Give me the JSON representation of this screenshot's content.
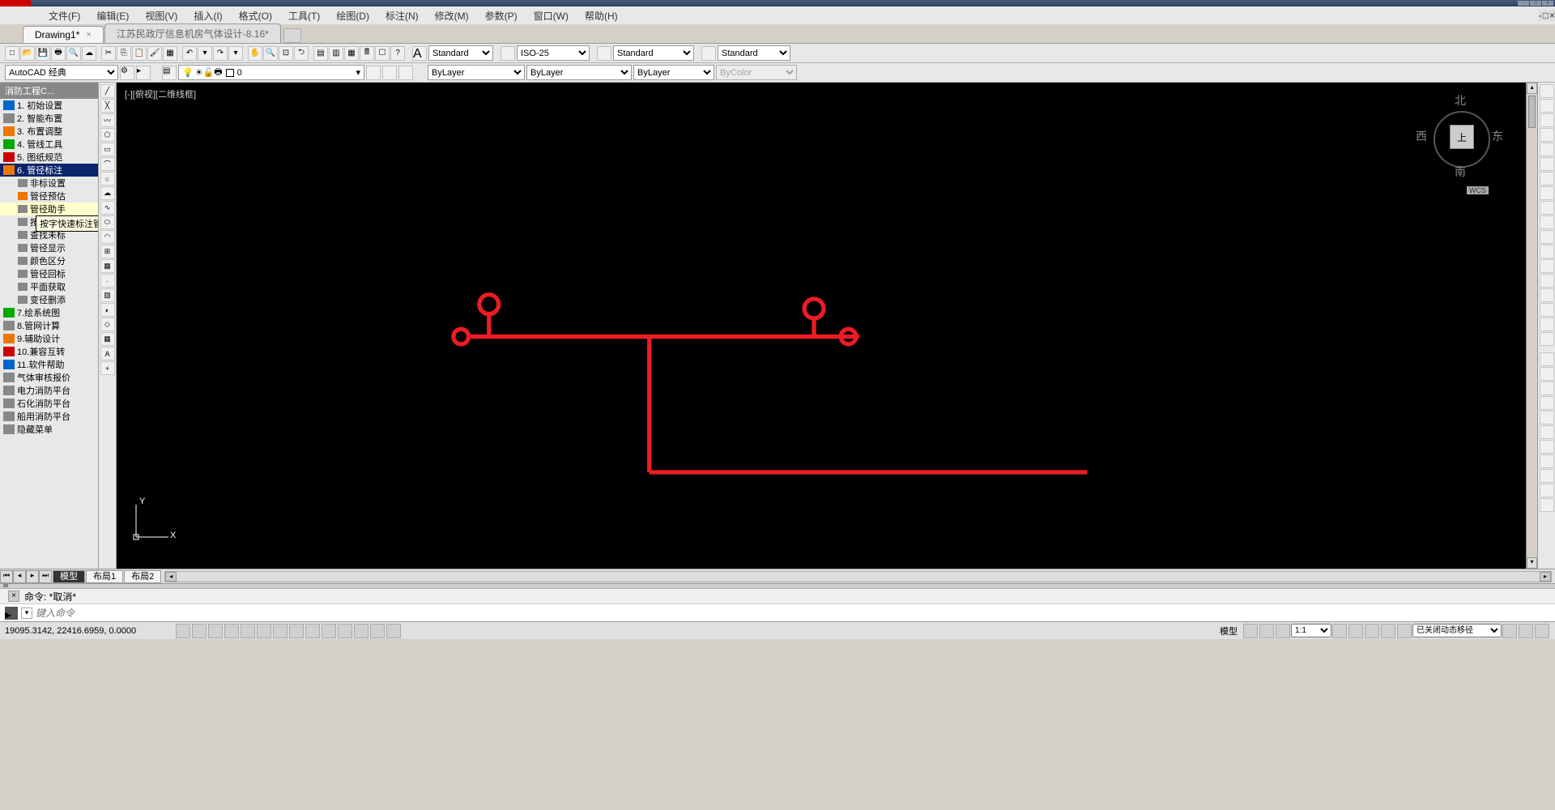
{
  "menubar": [
    "文件(F)",
    "编辑(E)",
    "视图(V)",
    "插入(I)",
    "格式(O)",
    "工具(T)",
    "绘图(D)",
    "标注(N)",
    "修改(M)",
    "参数(P)",
    "窗口(W)",
    "帮助(H)"
  ],
  "tabs": {
    "active": "Drawing1*",
    "inactive": "江苏民政厅信息机房气体设计-8.16*"
  },
  "styles": {
    "text": "Standard",
    "dim": "ISO-25",
    "table": "Standard",
    "ml": "Standard"
  },
  "workspace": "AutoCAD 经典",
  "layer": {
    "current": "0"
  },
  "props": {
    "color": "ByLayer",
    "ltype": "ByLayer",
    "lweight": "ByLayer",
    "plot": "ByColor"
  },
  "palette": {
    "title": "消防工程C...",
    "items": [
      {
        "n": "1.",
        "t": "初始设置"
      },
      {
        "n": "2.",
        "t": "智能布置"
      },
      {
        "n": "3.",
        "t": "布置调整"
      },
      {
        "n": "4.",
        "t": "管线工具"
      },
      {
        "n": "5.",
        "t": "图纸规范"
      },
      {
        "n": "6.",
        "t": "管径标注",
        "sel": true
      }
    ],
    "subs": [
      {
        "t": "非标设置"
      },
      {
        "t": "管径预估",
        "ico": "ico-orange"
      },
      {
        "t": "管径助手",
        "hover": true
      },
      {
        "t": "按字",
        "tip": "按字快速标注管径工具"
      },
      {
        "t": "查找未标"
      },
      {
        "t": "管径显示"
      },
      {
        "t": "颜色区分"
      },
      {
        "t": "管径回标"
      },
      {
        "t": "平面获取"
      },
      {
        "t": "变径删添"
      }
    ],
    "tail": [
      {
        "n": "7.",
        "t": "绘系统图"
      },
      {
        "n": "8.",
        "t": "管网计算"
      },
      {
        "n": "9.",
        "t": "辅助设计"
      },
      {
        "n": "10.",
        "t": "兼容互转"
      },
      {
        "n": "11.",
        "t": "软件帮助"
      }
    ],
    "ext": [
      "气体审核报价",
      "电力消防平台",
      "石化消防平台",
      "船用消防平台",
      "隐藏菜单"
    ]
  },
  "viewport": {
    "label": "[-][俯视][二维线框]"
  },
  "viewcube": {
    "n": "北",
    "s": "南",
    "e": "东",
    "w": "西",
    "top": "上",
    "wcs": "WCS"
  },
  "ucs": {
    "x": "X",
    "y": "Y"
  },
  "bottomtabs": [
    "模型",
    "布局1",
    "布局2"
  ],
  "cmd": {
    "hist": "命令: *取消*",
    "placeholder": "键入命令"
  },
  "status": {
    "coords": "19095.3142, 22416.6959, 0.0000",
    "model": "模型",
    "scale": "1:1",
    "dynin": "已关闭动态移径"
  }
}
